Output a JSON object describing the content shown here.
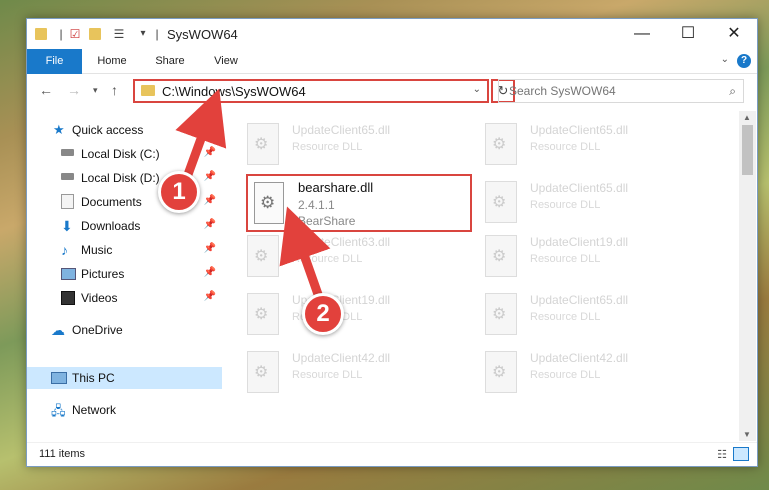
{
  "window": {
    "title": "SysWOW64",
    "controls": {
      "minimize": "—",
      "maximize": "☐",
      "close": "✕"
    }
  },
  "ribbon": {
    "tabs": [
      "File",
      "Home",
      "Share",
      "View"
    ],
    "help": "?"
  },
  "navigation": {
    "address_path": "C:\\Windows\\SysWOW64",
    "search_placeholder": "Search SysWOW64"
  },
  "sidebar": {
    "items": [
      {
        "label": "Quick access",
        "icon": "star-icon"
      },
      {
        "label": "Local Disk (C:)",
        "icon": "drive-icon",
        "pinned": true
      },
      {
        "label": "Local Disk (D:)",
        "icon": "drive-icon",
        "pinned": true
      },
      {
        "label": "Documents",
        "icon": "documents-icon",
        "pinned": true
      },
      {
        "label": "Downloads",
        "icon": "download-icon",
        "pinned": true
      },
      {
        "label": "Music",
        "icon": "music-icon",
        "pinned": true
      },
      {
        "label": "Pictures",
        "icon": "pictures-icon",
        "pinned": true
      },
      {
        "label": "Videos",
        "icon": "videos-icon",
        "pinned": true
      },
      {
        "label": "OneDrive",
        "icon": "cloud-icon"
      },
      {
        "label": "This PC",
        "icon": "computer-icon",
        "selected": true
      },
      {
        "label": "Network",
        "icon": "network-icon"
      }
    ]
  },
  "files": {
    "left": [
      {
        "name": "UpdateClient65.dll",
        "type": "Resource DLL"
      },
      {
        "name": "UpdateClient63.dll",
        "type": "Resource DLL"
      },
      {
        "name": "UpdateClient19.dll",
        "type": "Resource DLL"
      },
      {
        "name": "UpdateClient42.dll",
        "type": "Resource DLL"
      }
    ],
    "right": [
      {
        "name": "UpdateClient65.dll",
        "type": "Resource DLL"
      },
      {
        "name": "UpdateClient65.dll",
        "type": "Resource DLL"
      },
      {
        "name": "UpdateClient19.dll",
        "type": "Resource DLL"
      },
      {
        "name": "UpdateClient65.dll",
        "type": "Resource DLL"
      },
      {
        "name": "UpdateClient42.dll",
        "type": "Resource DLL"
      }
    ],
    "highlighted": {
      "name": "bearshare.dll",
      "version": "2.4.1.1",
      "company": "BearShare"
    }
  },
  "status": {
    "item_count": "111 items"
  },
  "annotations": {
    "step1": "1",
    "step2": "2",
    "accent": "#e2413c"
  }
}
